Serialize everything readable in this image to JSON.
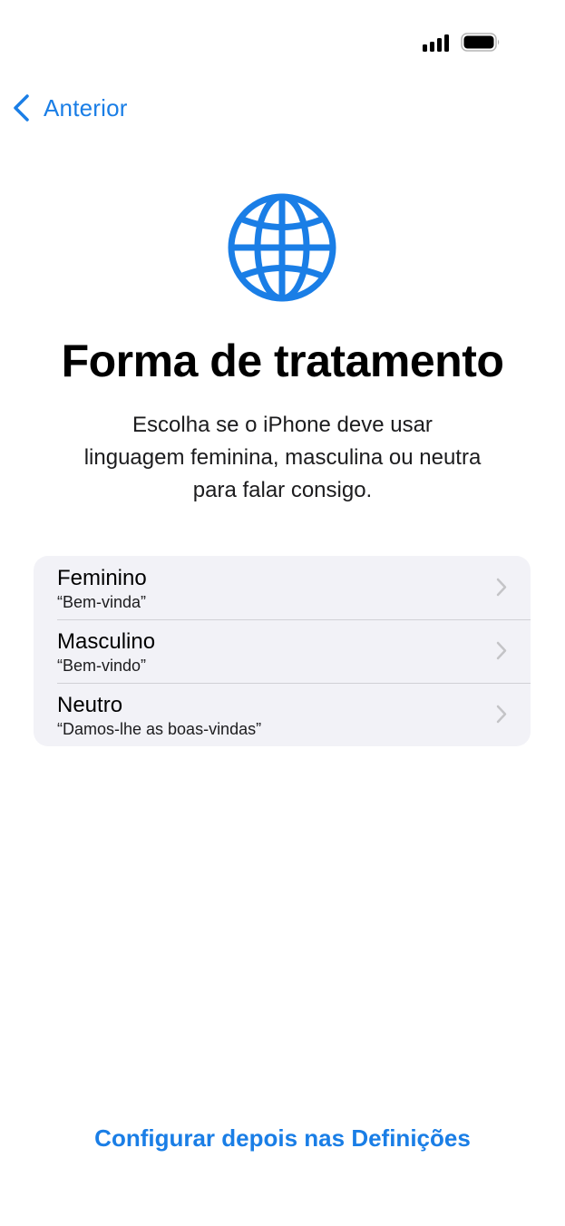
{
  "status_bar": {
    "signal_icon": "cellular-signal-icon",
    "battery_icon": "battery-icon"
  },
  "nav": {
    "back_label": "Anterior",
    "back_icon": "chevron-left-icon"
  },
  "header": {
    "icon": "globe-icon",
    "title": "Forma de tratamento",
    "subtitle": "Escolha se o iPhone deve usar linguagem feminina, masculina ou neutra para falar consigo."
  },
  "options": [
    {
      "label": "Feminino",
      "example": "“Bem-vinda”"
    },
    {
      "label": "Masculino",
      "example": "“Bem-vindo”"
    },
    {
      "label": "Neutro",
      "example": "“Damos-lhe as boas-vindas”"
    }
  ],
  "footer": {
    "link_label": "Configurar depois nas Definições"
  },
  "colors": {
    "accent": "#1a7ee6",
    "list_background": "#f2f2f7",
    "chevron": "#c4c4c7"
  }
}
